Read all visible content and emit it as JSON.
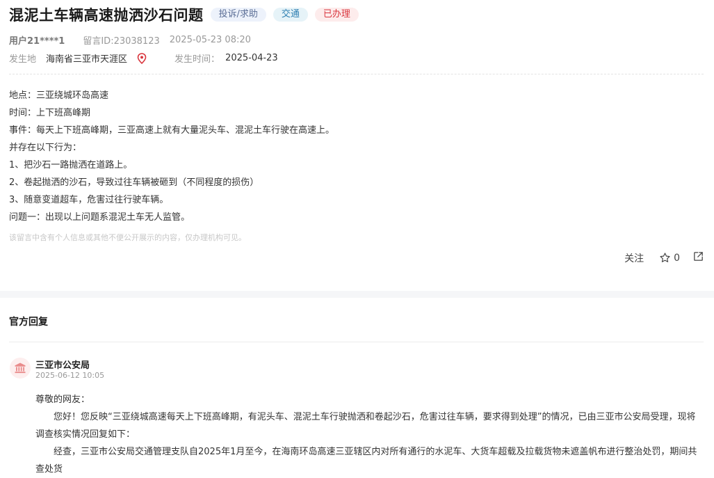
{
  "header": {
    "title": "混泥土车辆高速抛洒沙石问题",
    "tags": [
      {
        "label": "投诉/求助",
        "color": "#5b6e96"
      },
      {
        "label": "交通",
        "color": "#2e7fb1"
      },
      {
        "label": "已办理",
        "color": "#d9363e"
      }
    ]
  },
  "meta": {
    "user": "用户21****1",
    "message_id": "留言ID:23038123",
    "posted_at": "2025-05-23 08:20"
  },
  "location": {
    "label": "发生地",
    "value": "海南省三亚市天涯区",
    "time_label": "发生时间：",
    "time_value": "2025-04-23"
  },
  "content_lines": [
    "地点：三亚绕城环岛高速",
    "时间：上下班高峰期",
    "事件：每天上下班高峰期，三亚高速上就有大量泥头车、混泥土车行驶在高速上。",
    "并存在以下行为：",
    "1、把沙石一路抛洒在道路上。",
    "2、卷起抛洒的沙石，导致过往车辆被砸到（不同程度的损伤）",
    "3、随意变道超车，危害过往行驶车辆。",
    "问题一：出现以上问题系混泥土车无人监管。"
  ],
  "privacy_note": "该留言中含有个人信息或其他不便公开展示的内容，仅办理机构可见。",
  "actions": {
    "follow_label": "关注",
    "like_count": "0",
    "icons": [
      "star-icon",
      "share-icon"
    ]
  },
  "reply": {
    "section_title": "官方回复",
    "org_name": "三亚市公安局",
    "org_icon": "government-building-icon",
    "time": "2025-06-12 10:05",
    "greeting": "尊敬的网友：",
    "para1": "您好！您反映“三亚绕城高速每天上下班高峰期，有泥头车、混泥土车行驶抛洒和卷起沙石，危害过往车辆，要求得到处理”的情况，已由三亚市公安局受理，现将调查核实情况回复如下：",
    "para2": "经查，三亚市公安局交通管理支队自2025年1月至今，在海南环岛高速三亚辖区内对所有通行的水泥车、大货车超载及拉载货物未遮盖帆布进行整治处罚，期间共查处货"
  },
  "colors": {
    "accent_red": "#d9363e",
    "band": "#f5f6f8"
  }
}
